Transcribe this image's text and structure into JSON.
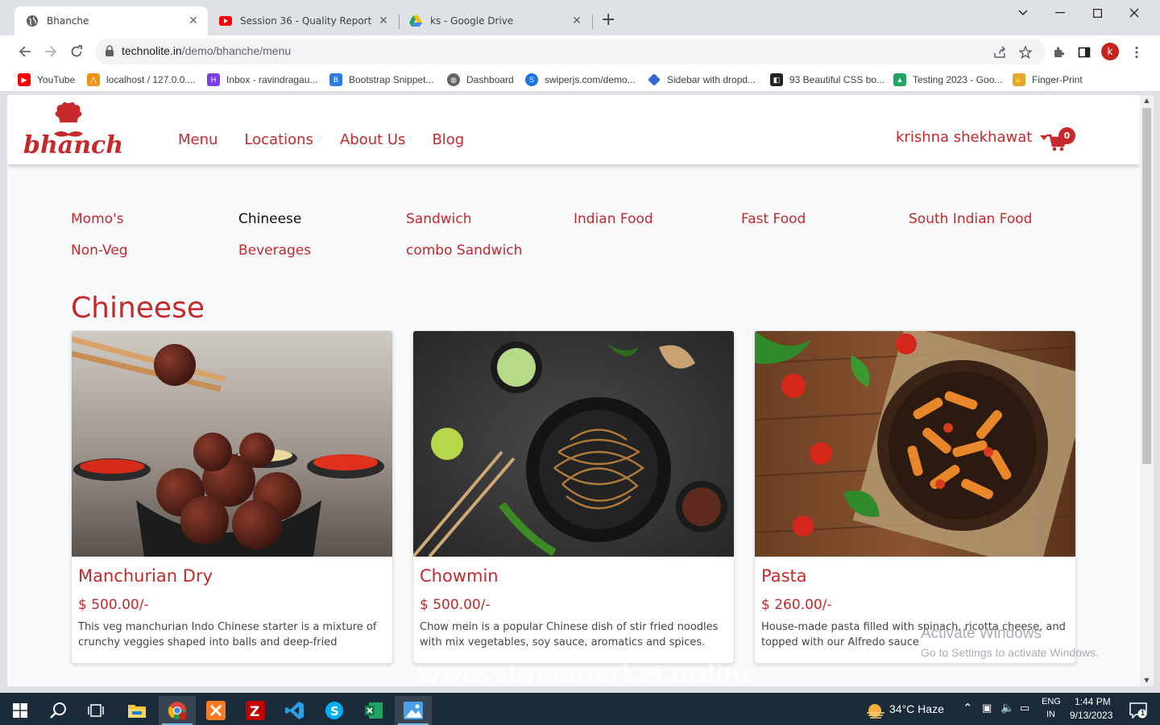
{
  "browser": {
    "tabs": [
      {
        "title": "Bhanche",
        "active": true
      },
      {
        "title": "Session 36 - Quality Report - India",
        "active": false
      },
      {
        "title": "ks - Google Drive",
        "active": false
      }
    ],
    "new_tab": "+",
    "close_glyph": "✕",
    "url_host": "technolite.in",
    "url_path": "/demo/bhanche/menu",
    "profile_initial": "k",
    "bookmarks": [
      {
        "label": "YouTube",
        "icon": "youtube-icon",
        "color": "#ff0000"
      },
      {
        "label": "localhost / 127.0.0....",
        "icon": "phpmyadmin-icon",
        "color": "#f29111"
      },
      {
        "label": "Inbox - ravindragau...",
        "icon": "mail-icon",
        "color": "#7b3fe4"
      },
      {
        "label": "Bootstrap Snippet...",
        "icon": "bootstrap-icon",
        "color": "#2c7be5"
      },
      {
        "label": "Dashboard",
        "icon": "globe-icon",
        "color": "#5f6368"
      },
      {
        "label": "swiperjs.com/demo...",
        "icon": "swiper-icon",
        "color": "#1a73e8"
      },
      {
        "label": "Sidebar with dropd...",
        "icon": "diamond-icon",
        "color": "#3367d6"
      },
      {
        "label": "93 Beautiful CSS bo...",
        "icon": "codepen-icon",
        "color": "#202124"
      },
      {
        "label": "Testing 2023 - Goo...",
        "icon": "drive-icon",
        "color": "#1fa463"
      },
      {
        "label": "Finger-Print",
        "icon": "fingerprint-icon",
        "color": "#e0a82e"
      }
    ]
  },
  "site": {
    "logo_text": "bhanche",
    "nav": [
      "Menu",
      "Locations",
      "About Us",
      "Blog"
    ],
    "user_name": "krishna shekhawat",
    "cart_count": "0",
    "categories": [
      {
        "label": "Momo's",
        "active": false
      },
      {
        "label": "Chineese",
        "active": true
      },
      {
        "label": "Sandwich",
        "active": false
      },
      {
        "label": "Indian Food",
        "active": false
      },
      {
        "label": "Fast Food",
        "active": false
      },
      {
        "label": "South Indian Food",
        "active": false
      },
      {
        "label": "Non-Veg",
        "active": false
      },
      {
        "label": "Beverages",
        "active": false
      },
      {
        "label": "combo Sandwich",
        "active": false
      }
    ],
    "section_title": "Chineese",
    "items": [
      {
        "name": "Manchurian Dry",
        "price": "$ 500.00/-",
        "desc": "This veg manchurian Indo Chinese starter is a mixture of crunchy veggies shaped into balls and deep-fried"
      },
      {
        "name": "Chowmin",
        "price": "$ 500.00/-",
        "desc": "Chow mein is a popular Chinese dish of stir fried noodles with mix vegetables, soy sauce, aromatics and spices."
      },
      {
        "name": "Pasta",
        "price": "$ 260.00/-",
        "desc": "House-made pasta filled with spinach, ricotta cheese, and topped with our Alfredo sauce"
      }
    ],
    "accent_color": "#c6282b"
  },
  "overlay": {
    "activate_title": "Activate Windows",
    "activate_sub": "Go to Settings to activate Windows.",
    "site_watermark": "www.stonemarket.online"
  },
  "taskbar": {
    "weather": "34°C  Haze",
    "lang_top": "ENG",
    "lang_bottom": "IN",
    "time": "1:44 PM",
    "date": "9/13/2023",
    "notif_count": "1"
  }
}
